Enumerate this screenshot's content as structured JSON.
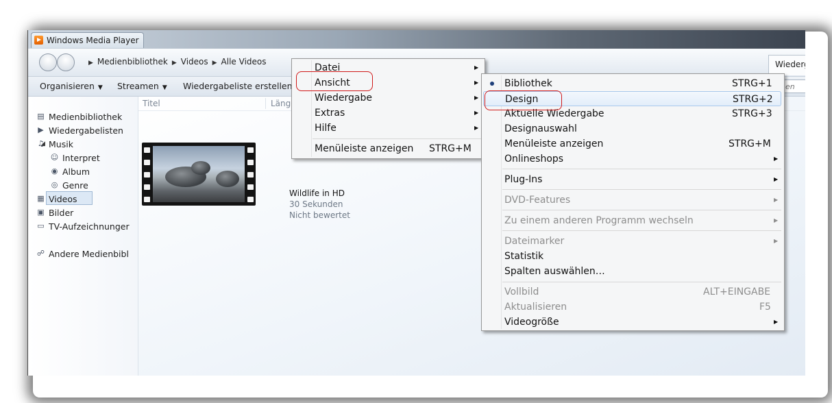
{
  "window": {
    "title": "Windows Media Player",
    "title_ghost": ""
  },
  "nav": {
    "breadcrumb": [
      "Medienbibliothek",
      "Videos",
      "Alle Videos"
    ],
    "play_tab_label": "Wiederg"
  },
  "toolbar": {
    "organize": "Organisieren",
    "stream": "Streamen",
    "create_playlist": "Wiedergabeliste erstellen",
    "search_placeholder": "en"
  },
  "sidebar": {
    "library": "Medienbibliothek",
    "playlists": "Wiedergabelisten",
    "music": "Musik",
    "artist": "Interpret",
    "album": "Album",
    "genre": "Genre",
    "videos": "Videos",
    "pictures": "Bilder",
    "tv": "TV-Aufzeichnunger",
    "other": "Andere Medienbibl"
  },
  "columns": {
    "title": "Titel",
    "length": "Länge"
  },
  "video": {
    "title": "Wildlife in HD",
    "duration": "30 Sekunden",
    "rating": "Nicht bewertet"
  },
  "main_menu": {
    "file": "Datei",
    "view": "Ansicht",
    "play": "Wiedergabe",
    "extras": "Extras",
    "help": "Hilfe",
    "show_menubar": "Menüleiste anzeigen",
    "show_menubar_shortcut": "STRG+M"
  },
  "view_menu": {
    "library": {
      "label": "Bibliothek",
      "shortcut": "STRG+1"
    },
    "skin": {
      "label": "Design",
      "shortcut": "STRG+2"
    },
    "now_playing": {
      "label": "Aktuelle Wiedergabe",
      "shortcut": "STRG+3"
    },
    "skin_chooser": {
      "label": "Designauswahl"
    },
    "show_menubar": {
      "label": "Menüleiste anzeigen",
      "shortcut": "STRG+M"
    },
    "online_stores": {
      "label": "Onlineshops"
    },
    "plugins": {
      "label": "Plug-Ins"
    },
    "dvd": {
      "label": "DVD-Features"
    },
    "switch_program": {
      "label": "Zu einem anderen Programm wechseln"
    },
    "file_markers": {
      "label": "Dateimarker"
    },
    "statistics": {
      "label": "Statistik"
    },
    "choose_columns": {
      "label": "Spalten auswählen…"
    },
    "fullscreen": {
      "label": "Vollbild",
      "shortcut": "ALT+EINGABE"
    },
    "refresh": {
      "label": "Aktualisieren",
      "shortcut": "F5"
    },
    "video_size": {
      "label": "Videogröße"
    }
  }
}
